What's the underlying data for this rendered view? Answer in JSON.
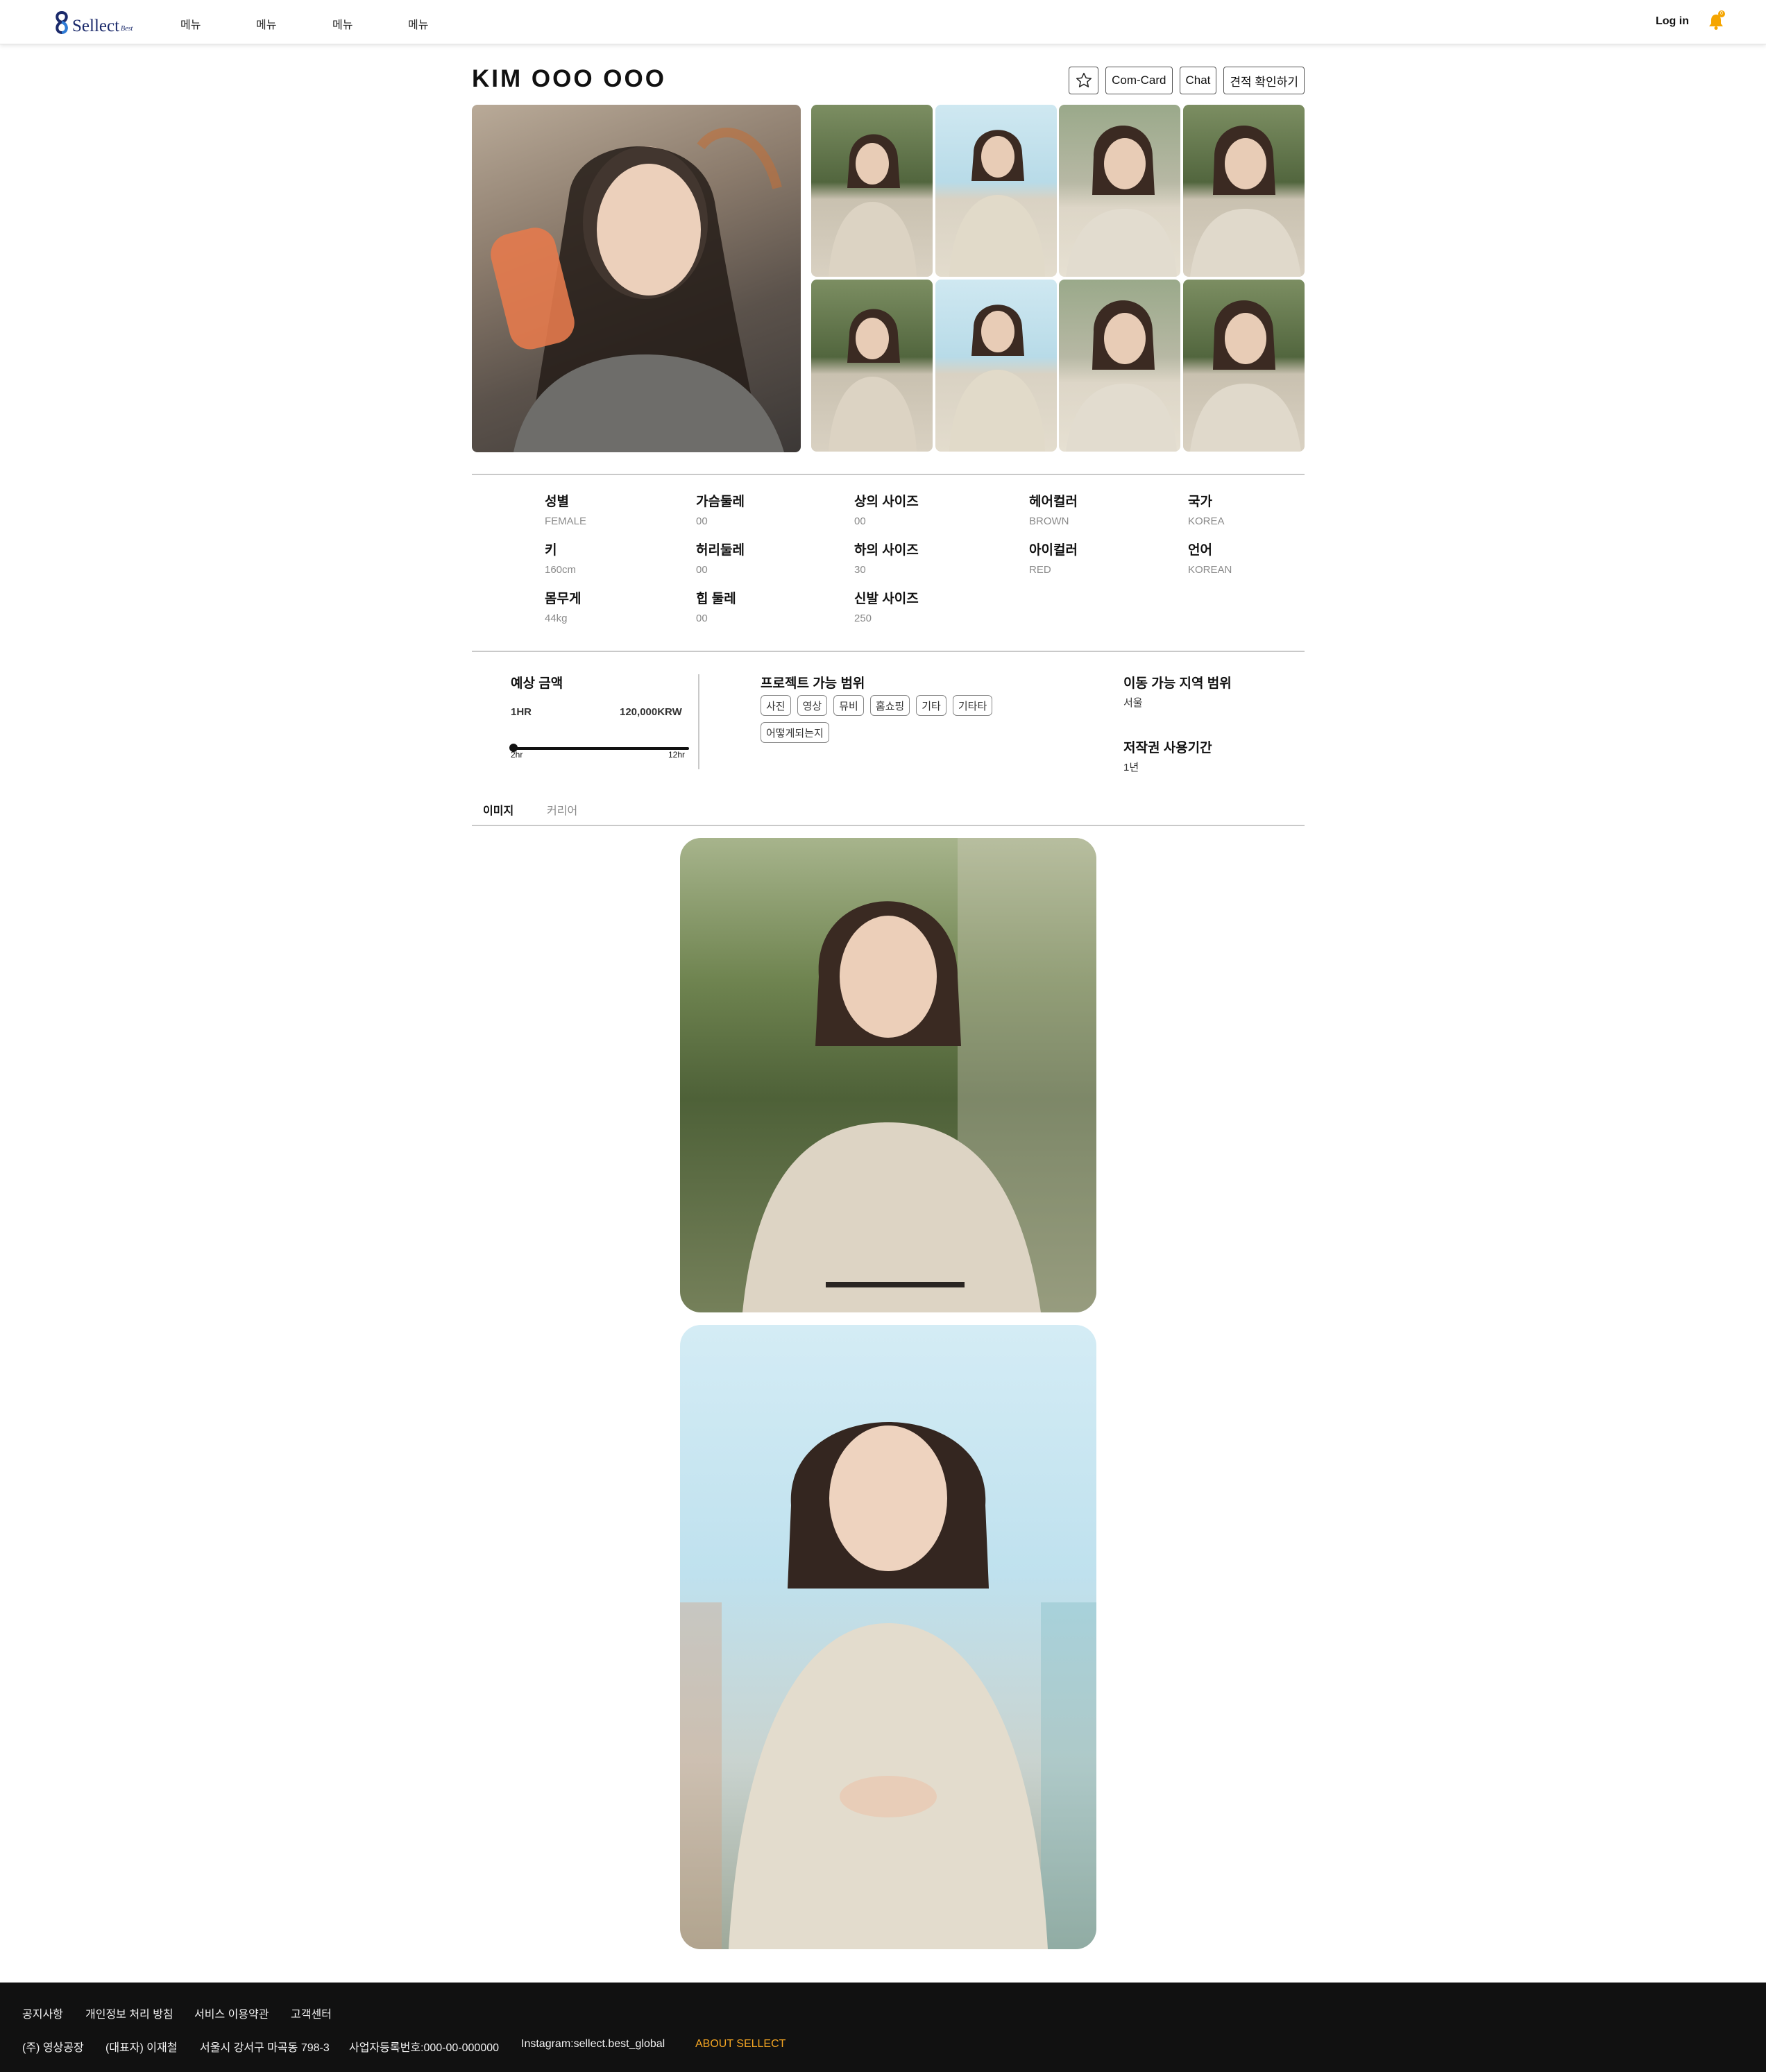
{
  "brand": {
    "logo_text": "Sellect",
    "logo_sub": "Best",
    "accent": "#1b2a6b",
    "badge_color": "#f5a500"
  },
  "nav": {
    "items": [
      "메뉴",
      "메뉴",
      "메뉴",
      "메뉴"
    ],
    "login": "Log in",
    "bell_count": "0"
  },
  "profile": {
    "name": "KIM OOO OOO",
    "actions": {
      "favorite_icon": "star-icon",
      "com_card": "Com-Card",
      "chat": "Chat",
      "quote": "견적 확인하기"
    }
  },
  "specs": [
    {
      "label": "성별",
      "value": "FEMALE"
    },
    {
      "label": "키",
      "value": "160cm"
    },
    {
      "label": "몸무게",
      "value": "44kg"
    },
    {
      "label": "가슴둘레",
      "value": "00"
    },
    {
      "label": "허리둘레",
      "value": "00"
    },
    {
      "label": "힙 둘레",
      "value": "00"
    },
    {
      "label": "상의 사이즈",
      "value": "00"
    },
    {
      "label": "하의 사이즈",
      "value": "30"
    },
    {
      "label": "신발 사이즈",
      "value": "250"
    },
    {
      "label": "헤어컬러",
      "value": "BROWN"
    },
    {
      "label": "아이컬러",
      "value": "RED"
    },
    {
      "label": "국가",
      "value": "KOREA"
    },
    {
      "label": "언어",
      "value": "KOREAN"
    }
  ],
  "price": {
    "title": "예상 금액",
    "unit": "1HR",
    "amount": "120,000KRW",
    "range_min_label": "2hr",
    "range_max_label": "12hr",
    "range_value": 0
  },
  "project": {
    "title": "프로젝트 가능 범위",
    "tags": [
      "사진",
      "영상",
      "뮤비",
      "홈쇼핑",
      "기타",
      "기타타",
      "어떻게되는지"
    ]
  },
  "area": {
    "title": "이동 가능 지역 범위",
    "value": "서울"
  },
  "copyright": {
    "title": "저작권 사용기간",
    "value": "1년"
  },
  "tabs": {
    "images": "이미지",
    "career": "커리어"
  },
  "footer": {
    "links": [
      "공지사항",
      "개인정보 처리 방침",
      "서비스 이용약관",
      "고객센터"
    ],
    "company": "(주) 영상공장",
    "ceo": "(대표자) 이재철",
    "address": "서울시 강서구 마곡동 798-3",
    "biz_no": "사업자등록번호:000-00-000000",
    "instagram": "Instagram:sellect.best_global",
    "about": "ABOUT SELLECT",
    "about_color": "#f5a623"
  }
}
